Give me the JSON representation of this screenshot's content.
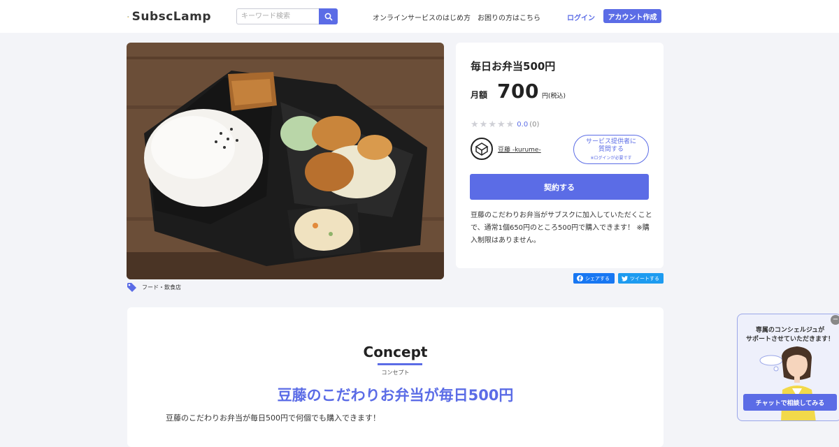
{
  "header": {
    "logo_text": "SubscLamp",
    "search_placeholder": "キーワード検索",
    "nav_links": [
      "オンラインサービスのはじめ方",
      "お困りの方はこちら"
    ],
    "login_label": "ログイン",
    "signup_label": "アカウント作成"
  },
  "product": {
    "title": "毎日お弁当500円",
    "price_label": "月額",
    "price_value": "700",
    "price_unit": "円(税込)",
    "rating_score": "0.0",
    "rating_count": "(0)",
    "rating_stars": 0,
    "provider_name": "豆藤 -kurume-",
    "ask_button_lines": [
      "サービス提供者に",
      "質問する"
    ],
    "ask_button_note": "※ログインが必要です",
    "contract_label": "契約する",
    "description": "豆藤のこだわりお弁当がサブスクに加入していただくことで、通常1個650円のところ500円で購入できます！ ※購入制限はありません。",
    "category": "フード・飲食店"
  },
  "share": {
    "facebook_label": "シェアする",
    "twitter_label": "ツイートする"
  },
  "concept": {
    "heading": "Concept",
    "subheading": "コンセプト",
    "title": "豆藤のこだわりお弁当が毎日500円",
    "body": "豆藤のこだわりお弁当が毎日500円で何個でも購入できます！"
  },
  "concierge": {
    "lines": [
      "専属のコンシェルジュが",
      "サポートさせていただきます！"
    ],
    "chat_label": "チャットで相談してみる"
  },
  "colors": {
    "accent": "#5b6ce6",
    "page_bg": "#f3f4f8",
    "facebook": "#1877f2",
    "twitter": "#1d9bf0"
  }
}
